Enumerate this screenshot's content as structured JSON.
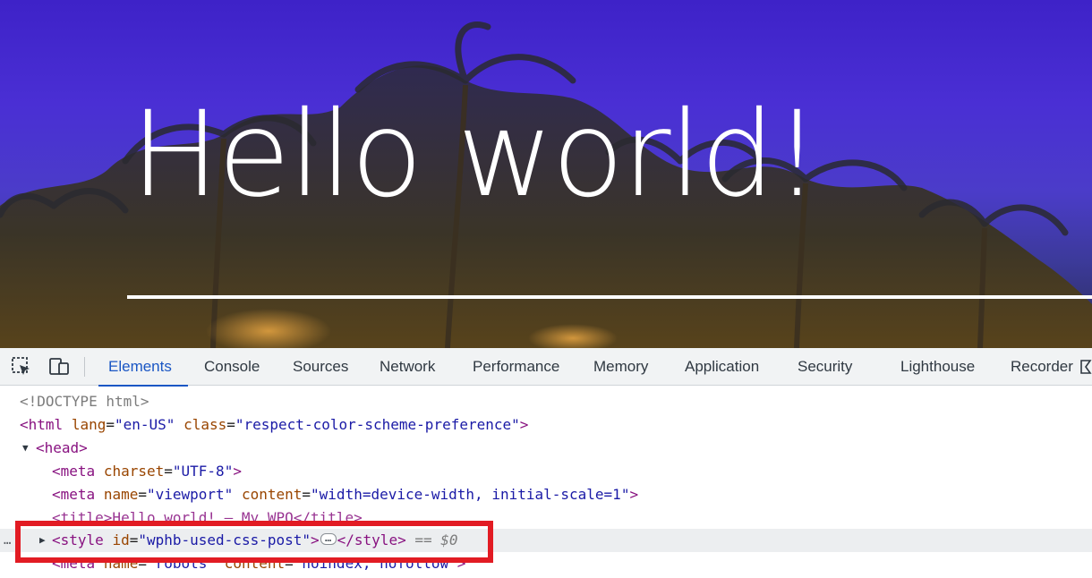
{
  "page": {
    "title": "Hello world!"
  },
  "devtools": {
    "icons": {
      "inspect": "inspect-element-icon",
      "device": "device-toolbar-icon",
      "recorder": "recorder-icon"
    },
    "tabs": [
      {
        "label": "Elements",
        "active": true
      },
      {
        "label": "Console"
      },
      {
        "label": "Sources"
      },
      {
        "label": "Network"
      },
      {
        "label": "Performance"
      },
      {
        "label": "Memory"
      },
      {
        "label": "Application"
      },
      {
        "label": "Security"
      },
      {
        "label": "Lighthouse"
      },
      {
        "label": "Recorder"
      }
    ],
    "accent": "#1a56c4"
  },
  "tree": {
    "doctype": "<!DOCTYPE html>",
    "html": {
      "tag_open": "<html",
      "lang_name": "lang",
      "lang_value": "\"en-US\"",
      "class_name": "class",
      "class_value": "\"respect-color-scheme-preference\"",
      "tag_close": ">"
    },
    "head": {
      "tag": "<head>"
    },
    "meta_charset": {
      "tag_open": "<meta",
      "attr_name": "charset",
      "attr_value": "\"UTF-8\"",
      "tag_close": ">"
    },
    "meta_viewport": {
      "tag_open": "<meta",
      "name_attr": "name",
      "name_value": "\"viewport\"",
      "content_attr": "content",
      "content_value": "\"width=device-width, initial-scale=1\"",
      "tag_close": ">"
    },
    "title_partial": "<title>Hello world! – My WPO</title>",
    "style": {
      "tag_open": "<style",
      "id_name": "id",
      "id_value": "\"wphb-used-css-post\"",
      "tag_end": ">",
      "ellipsis": "…",
      "close_tag": "</style>",
      "selected_marker": "== $0"
    },
    "meta_robots": {
      "tag_open": "<meta",
      "name_attr": "name",
      "name_value": "\"robots\"",
      "content_attr": "content",
      "content_value": "\"noindex, nofollow\"",
      "tag_close": ">"
    },
    "gutter": "…"
  },
  "highlight_color": "#e21b23"
}
